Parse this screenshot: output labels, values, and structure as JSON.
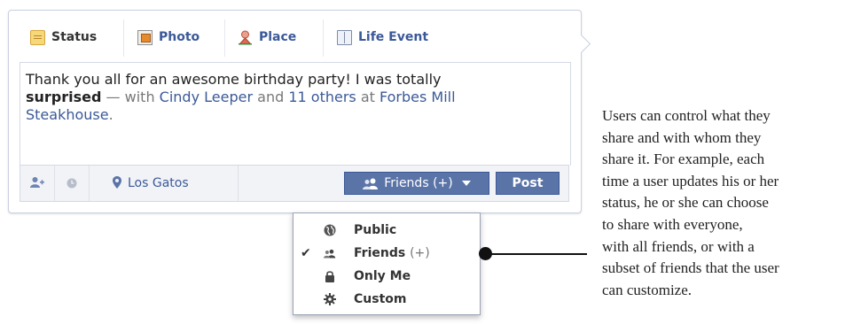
{
  "composer": {
    "tabs": [
      {
        "label": "Status",
        "icon": "status-note-icon",
        "active": true
      },
      {
        "label": "Photo",
        "icon": "photo-icon",
        "active": false
      },
      {
        "label": "Place",
        "icon": "place-person-icon",
        "active": false
      },
      {
        "label": "Life Event",
        "icon": "life-event-book-icon",
        "active": false
      }
    ],
    "status": {
      "line1": "Thank you all for an awesome birthday party! I was totally",
      "bold_word": "surprised",
      "with_text": " — with ",
      "friend_name": "Cindy Leeper",
      "and_text": " and ",
      "others_link": "11 others",
      "at_text": " at ",
      "place_part1": "Forbes Mill",
      "place_part2": "Steakhouse",
      "period": "."
    },
    "footer": {
      "tag_people_icon": "add-person-icon",
      "time_icon": "clock-icon",
      "location_icon": "map-pin-icon",
      "location": "Los Gatos",
      "audience_label": "Friends (+)",
      "post_label": "Post"
    }
  },
  "audience_menu": {
    "items": [
      {
        "label": "Public",
        "suffix": "",
        "icon": "globe-icon",
        "checked": false
      },
      {
        "label": "Friends",
        "suffix": "(+)",
        "icon": "friends-icon",
        "checked": true
      },
      {
        "label": "Only Me",
        "suffix": "",
        "icon": "lock-icon",
        "checked": false
      },
      {
        "label": "Custom",
        "suffix": "",
        "icon": "gear-icon",
        "checked": false
      }
    ],
    "check_mark": "✔"
  },
  "caption": {
    "lines": [
      "Users can control what they",
      "share and with whom they",
      "share it. For example, each",
      "time a user updates his or her",
      "status, he or she can choose",
      "to share with everyone,",
      "with all friends, or with a",
      "subset of friends that the user",
      "can customize."
    ]
  },
  "colors": {
    "link": "#3b5998",
    "button": "#5b74a8",
    "footer_bg": "#f2f3f7"
  }
}
